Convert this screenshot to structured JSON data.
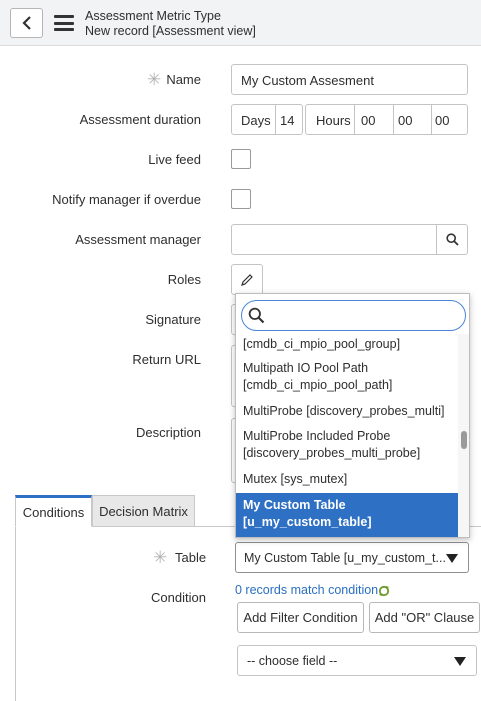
{
  "header": {
    "title": "Assessment Metric Type",
    "subtitle": "New record [Assessment view]"
  },
  "form": {
    "name": {
      "label": "Name",
      "value": "My Custom Assesment"
    },
    "duration": {
      "label": "Assessment duration",
      "days_label": "Days",
      "days_value": "14",
      "hours_label": "Hours",
      "hours_value": "00",
      "minutes_value": "00",
      "seconds_value": "00"
    },
    "live_feed": {
      "label": "Live feed"
    },
    "notify_manager": {
      "label": "Notify manager if overdue"
    },
    "assessment_manager": {
      "label": "Assessment manager",
      "value": ""
    },
    "roles": {
      "label": "Roles"
    },
    "signature": {
      "label": "Signature"
    },
    "return_url": {
      "label": "Return URL"
    },
    "description": {
      "label": "Description"
    }
  },
  "dropdown": {
    "search_value": "",
    "items": [
      {
        "line1": "[cmdb_ci_mpio_pool_group]",
        "line2": ""
      },
      {
        "line1": "Multipath IO Pool Path",
        "line2": "[cmdb_ci_mpio_pool_path]"
      },
      {
        "line1": "MultiProbe [discovery_probes_multi]",
        "line2": ""
      },
      {
        "line1": "MultiProbe Included Probe",
        "line2": "[discovery_probes_multi_probe]"
      },
      {
        "line1": "Mutex [sys_mutex]",
        "line2": ""
      },
      {
        "line1": "My Custom Table",
        "line2": "[u_my_custom_table]"
      }
    ],
    "selected_index": 5
  },
  "tabs": [
    {
      "label": "Conditions"
    },
    {
      "label": "Decision Matrix"
    }
  ],
  "conditions": {
    "table_label": "Table",
    "table_value": "My Custom Table [u_my_custom_t...",
    "condition_label": "Condition",
    "records_match": "0 records match condition",
    "add_filter_label": "Add Filter Condition",
    "add_or_label": "Add \"OR\" Clause",
    "choose_field": "-- choose field --"
  },
  "colors": {
    "accent": "#2e70c4",
    "link": "#2a6fc2",
    "header_bg": "#f1f3f4"
  },
  "icons": {
    "back": "chevron-left-icon",
    "menu": "hamburger-menu-icon",
    "search": "magnifier-icon",
    "edit": "pencil-icon",
    "dropdown": "caret-down-icon",
    "refresh": "refresh-icon"
  }
}
